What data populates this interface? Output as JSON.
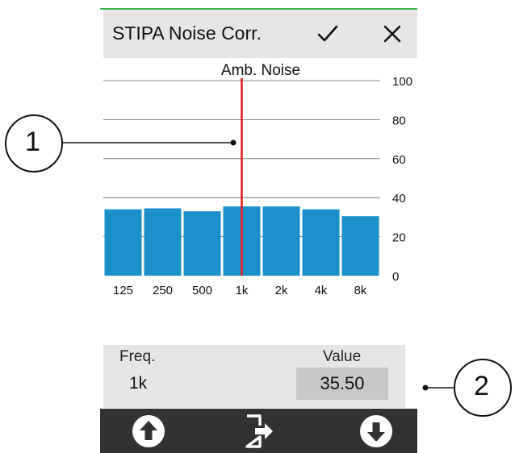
{
  "titlebar": {
    "title": "STIPA Noise Corr.",
    "confirm_icon": "checkmark-icon",
    "close_icon": "close-icon"
  },
  "chart_data": {
    "type": "bar",
    "title": "Amb. Noise",
    "categories": [
      "125",
      "250",
      "500",
      "1k",
      "2k",
      "4k",
      "8k"
    ],
    "values": [
      34,
      34.5,
      33,
      35.5,
      35.5,
      34,
      30.5
    ],
    "ylim": [
      0,
      100
    ],
    "yticks": [
      0,
      20,
      40,
      60,
      80,
      100
    ],
    "grid": true,
    "selected_category": "1k",
    "bar_color": "#1a8fc9",
    "cursor_color": "#e02020"
  },
  "panel": {
    "freq_label": "Freq.",
    "value_label": "Value",
    "freq_value": "1k",
    "value": "35.50"
  },
  "bottombar": {
    "left_icon": "arrow-up-circle-icon",
    "center_icon": "exit-icon",
    "right_icon": "arrow-down-circle-icon"
  },
  "callouts": [
    "1",
    "2"
  ]
}
